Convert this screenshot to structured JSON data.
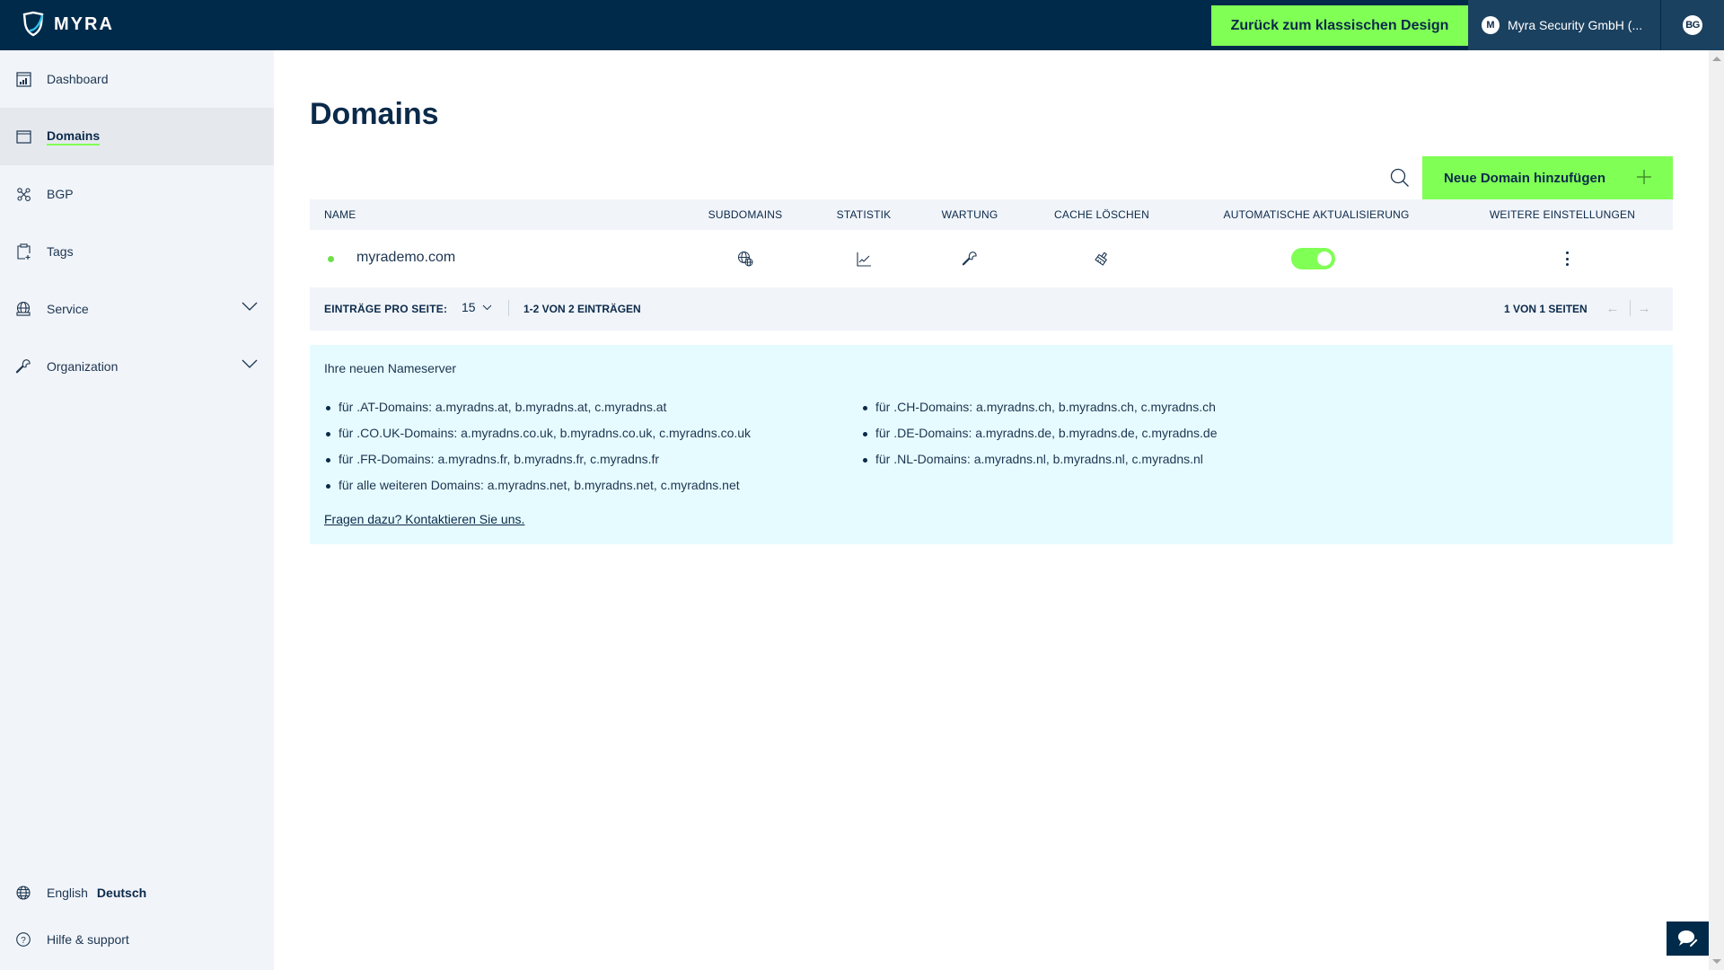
{
  "header": {
    "logo_text": "MYRA",
    "classic_design_label": "Zurück zum klassischen Design",
    "organization": {
      "initial": "M",
      "name": "Myra Security GmbH (..."
    },
    "user_initials": "BG"
  },
  "sidebar": {
    "items": [
      {
        "label": "Dashboard",
        "icon": "dashboard-icon",
        "active": false,
        "expandable": false
      },
      {
        "label": "Domains",
        "icon": "browser-window-icon",
        "active": true,
        "expandable": false
      },
      {
        "label": "BGP",
        "icon": "network-nodes-icon",
        "active": false,
        "expandable": false
      },
      {
        "label": "Tags",
        "icon": "clipboard-plus-icon",
        "active": false,
        "expandable": false
      },
      {
        "label": "Service",
        "icon": "globe-service-icon",
        "active": false,
        "expandable": true
      },
      {
        "label": "Organization",
        "icon": "wrench-icon",
        "active": false,
        "expandable": true
      }
    ],
    "languages": [
      {
        "label": "English",
        "active": false
      },
      {
        "label": "Deutsch",
        "active": true
      }
    ],
    "help_label": "Hilfe & support"
  },
  "main": {
    "title": "Domains",
    "add_domain_label": "Neue Domain hinzufügen",
    "table": {
      "columns": [
        "Name",
        "Subdomains",
        "Statistik",
        "Wartung",
        "Cache löschen",
        "Automatische Aktualisierung",
        "Weitere Einstellungen"
      ],
      "rows": [
        {
          "name": "myrademo.com",
          "status": "active",
          "auto_update": true
        }
      ]
    },
    "pagination": {
      "per_page_label": "EINTRÄGE PRO SEITE:",
      "per_page_value": "15",
      "range_label": "1-2 VON 2 EINTRÄGEN",
      "pages_label": "1 VON 1 SEITEN",
      "prev_icon": "arrow-left-icon",
      "next_icon": "arrow-right-icon"
    },
    "nameservers": {
      "title": "Ihre neuen Nameserver",
      "left": [
        "für .AT-Domains: a.myradns.at, b.myradns.at, c.myradns.at",
        "für .CO.UK-Domains: a.myradns.co.uk, b.myradns.co.uk, c.myradns.co.uk",
        "für .FR-Domains: a.myradns.fr, b.myradns.fr, c.myradns.fr",
        "für alle weiteren Domains: a.myradns.net, b.myradns.net, c.myradns.net"
      ],
      "right": [
        "für .CH-Domains: a.myradns.ch, b.myradns.ch, c.myradns.ch",
        "für .DE-Domains: a.myradns.de, b.myradns.de, c.myradns.de",
        "für .NL-Domains: a.myradns.nl, b.myradns.nl, c.myradns.nl"
      ],
      "contact_link": "Fragen dazu? Kontaktieren Sie uns."
    }
  },
  "colors": {
    "navy": "#002a4a",
    "accent_green": "#80ff55",
    "sidebar_bg": "#f1f4f9",
    "info_bg": "#e6fbff"
  }
}
